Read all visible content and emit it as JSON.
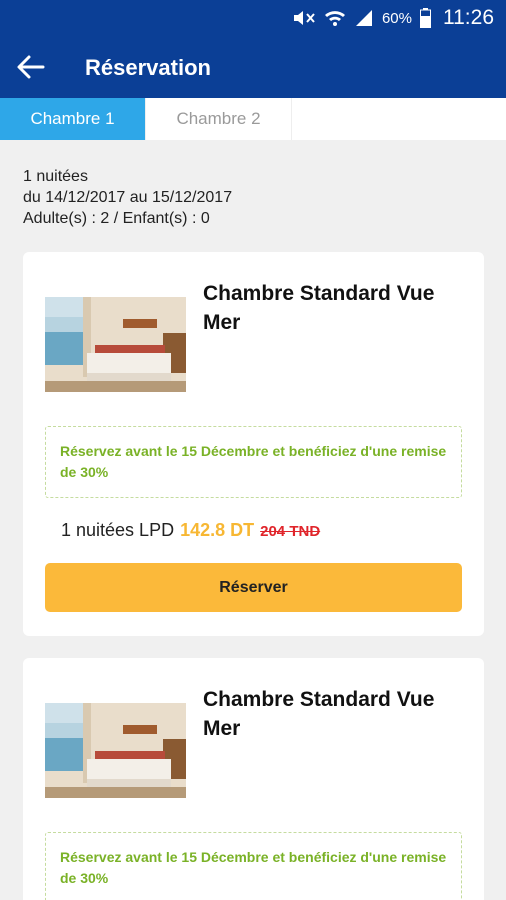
{
  "status_bar": {
    "battery": "60%",
    "time": "11:26"
  },
  "header": {
    "title": "Réservation"
  },
  "tabs": [
    {
      "label": "Chambre 1",
      "active": true
    },
    {
      "label": "Chambre 2",
      "active": false
    }
  ],
  "summary": {
    "nights": "1 nuitées",
    "dates": "du 14/12/2017 au 15/12/2017",
    "guests": "Adulte(s) : 2 / Enfant(s) : 0"
  },
  "offers": [
    {
      "title": "Chambre Standard Vue Mer",
      "promo": "Réservez avant le 15 Décembre et benéficiez d'une remise de 30%",
      "nights_label": "1 nuitées LPD",
      "price": "142.8 DT",
      "old_price": "204 TND",
      "button": "Réserver"
    },
    {
      "title": "Chambre Standard Vue Mer",
      "promo": "Réservez avant le 15 Décembre et benéficiez d'une remise de 30%"
    }
  ],
  "colors": {
    "primary": "#0b3f96",
    "tab_active": "#2ea7e8",
    "accent": "#fbb93a",
    "promo": "#7ab227",
    "old_price": "#e0252b"
  }
}
